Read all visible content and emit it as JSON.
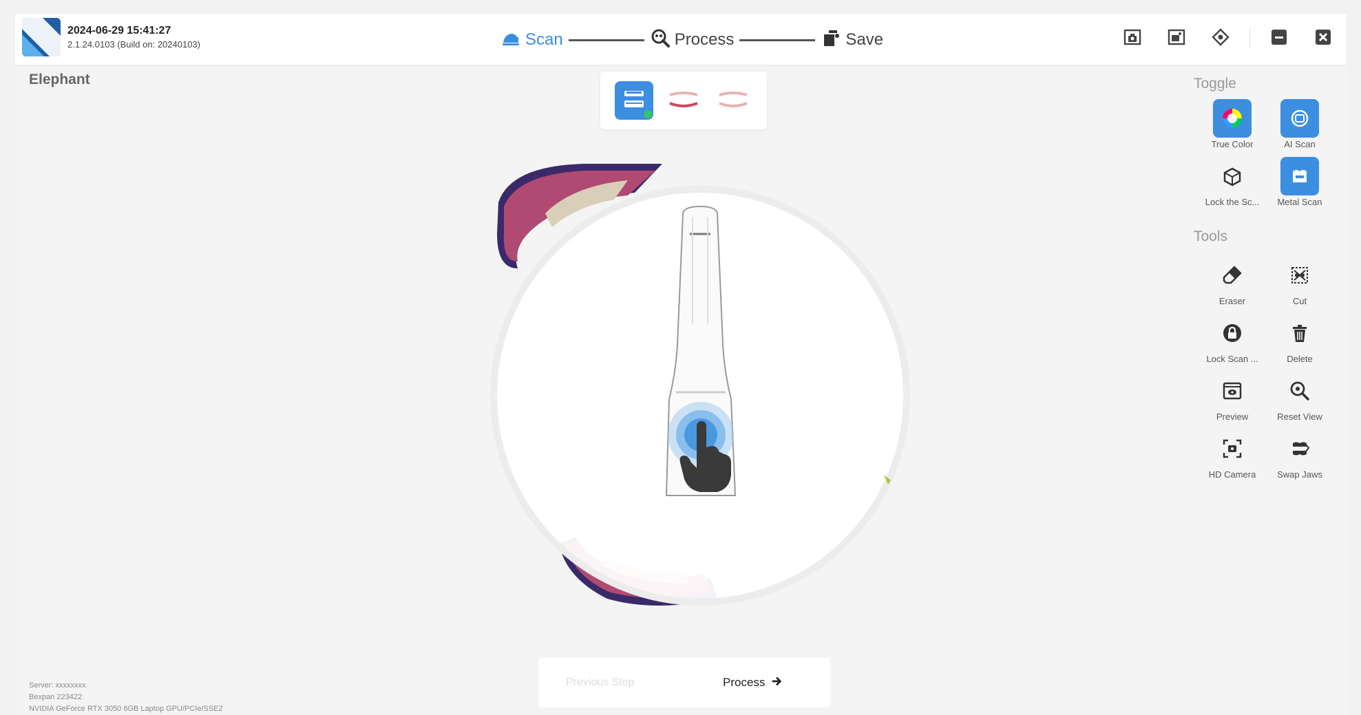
{
  "header": {
    "datetime": "2024-06-29 15:41:27",
    "version": "2.1.24.0103 (Build on: 20240103)",
    "steps": [
      {
        "label": "Scan",
        "icon": "scan-icon",
        "active": true
      },
      {
        "label": "Process",
        "icon": "process-icon",
        "active": false
      },
      {
        "label": "Save",
        "icon": "save-icon",
        "active": false
      }
    ],
    "buttons": [
      "screenshot-icon",
      "image-icon",
      "settings-icon",
      "minimize-icon",
      "close-icon"
    ]
  },
  "case_name": "Elephant",
  "jaw_selector": {
    "items": [
      "upper-lower-jaw-icon",
      "upper-jaw-icon",
      "lower-jaw-icon"
    ],
    "active_index": 0
  },
  "right_panel": {
    "toggle_title": "Toggle",
    "toggles": [
      {
        "label": "True Color",
        "icon": "color-wheel-icon",
        "on": true
      },
      {
        "label": "AI Scan",
        "icon": "ai-icon",
        "on": true
      },
      {
        "label": "Lock the Sc...",
        "icon": "lock-cube-icon",
        "on": false
      },
      {
        "label": "Metal Scan",
        "icon": "metal-icon",
        "on": true
      }
    ],
    "tools_title": "Tools",
    "tools": [
      {
        "label": "Eraser",
        "icon": "eraser-icon"
      },
      {
        "label": "Cut",
        "icon": "cut-icon"
      },
      {
        "label": "Lock Scan ...",
        "icon": "lock-icon"
      },
      {
        "label": "Delete",
        "icon": "trash-icon"
      },
      {
        "label": "Preview",
        "icon": "preview-icon"
      },
      {
        "label": "Reset View",
        "icon": "reset-view-icon"
      },
      {
        "label": "HD Camera",
        "icon": "hd-camera-icon"
      },
      {
        "label": "Swap Jaws",
        "icon": "swap-jaws-icon"
      }
    ]
  },
  "bottom": {
    "prev_label": "Previous Step",
    "process_label": "Process"
  },
  "sysinfo": [
    "Server: xxxxxxxx",
    "Bexpan 223422",
    "NVIDIA GeForce RTX 3050 6GB Laptop GPU/PCIe/SSE2"
  ],
  "colors": {
    "accent": "#3c8ee0",
    "gum": "#b04a72",
    "tooth": "#d9cfb8",
    "scan_edge": "#3a2a6a"
  }
}
